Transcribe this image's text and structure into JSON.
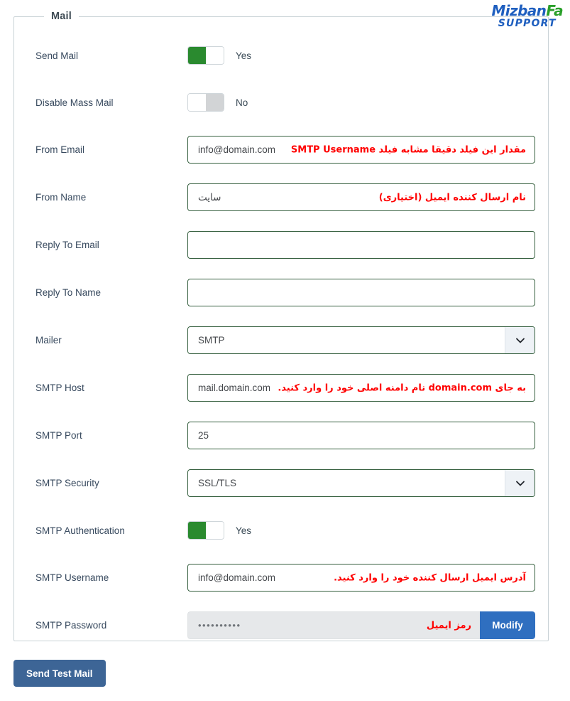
{
  "fieldset": {
    "legend": "Mail"
  },
  "logo": {
    "name_main": "Mizban",
    "name_accent": "Fa",
    "subtitle": "SUPPORT",
    "color_main": "#1f5fbf",
    "color_accent": "#2aa02a"
  },
  "rows": {
    "send_mail": {
      "label": "Send Mail",
      "toggle_state": "on",
      "toggle_text": "Yes"
    },
    "disable_mass_mail": {
      "label": "Disable Mass Mail",
      "toggle_state": "off",
      "toggle_text": "No"
    },
    "from_email": {
      "label": "From Email",
      "value": "info@domain.com",
      "annotation": "مقدار این فیلد دقیقا مشابه فیلد SMTP Username"
    },
    "from_name": {
      "label": "From Name",
      "value": "سایت",
      "annotation": "نام ارسال کننده ایمیل (اختیاری)"
    },
    "reply_to_email": {
      "label": "Reply To Email",
      "value": ""
    },
    "reply_to_name": {
      "label": "Reply To Name",
      "value": ""
    },
    "mailer": {
      "label": "Mailer",
      "value": "SMTP"
    },
    "smtp_host": {
      "label": "SMTP Host",
      "value": "mail.domain.com",
      "annotation": "به جای domain.com نام دامنه اصلی خود را وارد کنید."
    },
    "smtp_port": {
      "label": "SMTP Port",
      "value": "25"
    },
    "smtp_security": {
      "label": "SMTP Security",
      "value": "SSL/TLS"
    },
    "smtp_authentication": {
      "label": "SMTP Authentication",
      "toggle_state": "on",
      "toggle_text": "Yes"
    },
    "smtp_username": {
      "label": "SMTP Username",
      "value": "info@domain.com",
      "annotation": "آدرس ایمیل ارسال کننده خود را وارد کنید."
    },
    "smtp_password": {
      "label": "SMTP Password",
      "value": "••••••••••",
      "annotation": "رمز ایمیل",
      "modify_label": "Modify"
    }
  },
  "footer": {
    "send_test_mail_label": "Send Test Mail"
  },
  "colors": {
    "input_border": "#36603f",
    "toggle_on": "#2a8a2f",
    "toggle_off": "#d2d4d6",
    "annotation_red": "#ff0000",
    "modify_blue": "#2f6fc0",
    "test_button_blue": "#3d6596",
    "label_text": "#37495e"
  }
}
